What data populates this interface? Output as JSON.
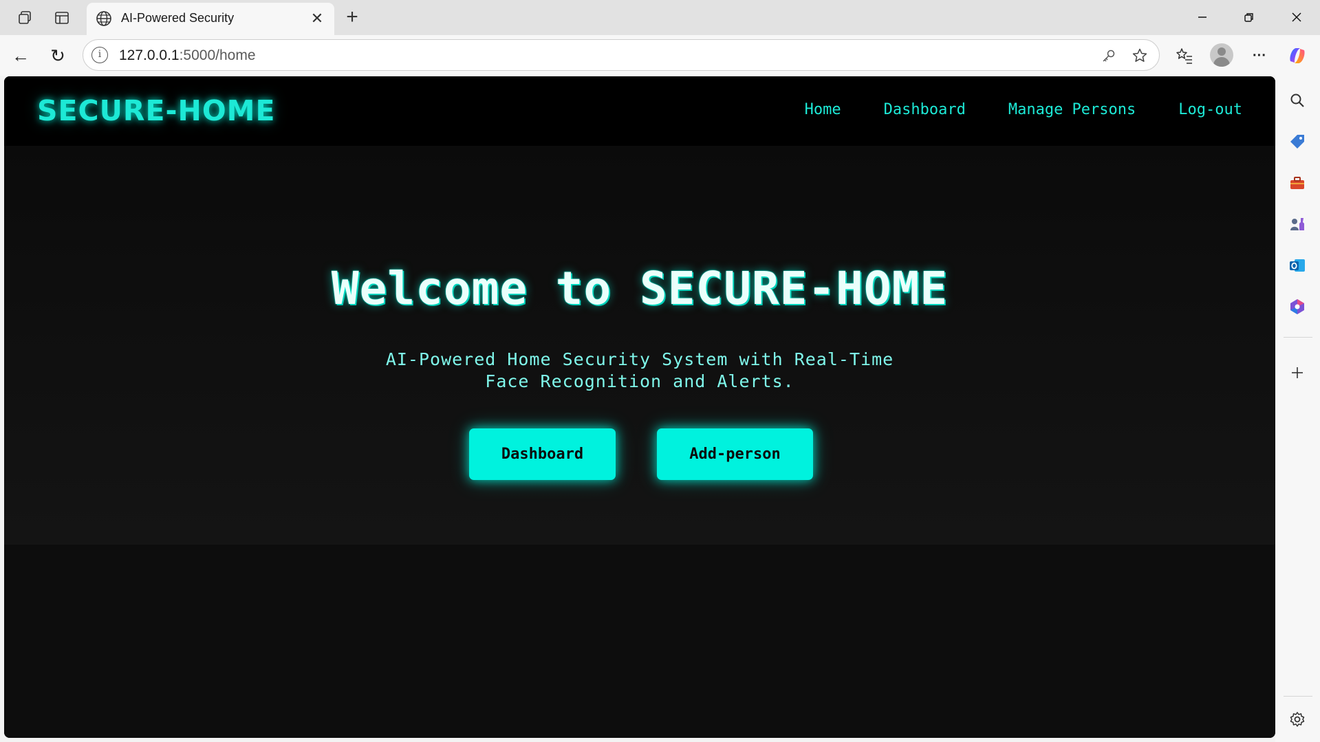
{
  "browser": {
    "tab_title": "AI-Powered Security",
    "url_host": "127.0.0.1",
    "url_path": ":5000/home",
    "close_glyph": "✕",
    "new_tab_glyph": "+",
    "minimize_glyph": "—",
    "restore_glyph": "❐",
    "window_close_glyph": "✕",
    "back_glyph": "←",
    "reload_glyph": "↻",
    "more_glyph": "···",
    "info_glyph": "i"
  },
  "site": {
    "brand": "SECURE-HOME",
    "nav": [
      {
        "label": "Home"
      },
      {
        "label": "Dashboard"
      },
      {
        "label": "Manage Persons"
      },
      {
        "label": "Log-out"
      }
    ],
    "hero_title": "Welcome to SECURE-HOME",
    "hero_subtitle": "AI-Powered Home Security System with Real-Time Face Recognition and Alerts.",
    "buttons": {
      "dashboard": "Dashboard",
      "add_person": "Add-person"
    }
  },
  "colors": {
    "accent": "#1de9d6",
    "button_bg": "#00f2de",
    "page_bg": "#0c0c0c",
    "nav_bg": "#000000"
  },
  "icons": {
    "sidebar": [
      "search-icon",
      "shopping-tag-icon",
      "toolbox-icon",
      "games-icon",
      "outlook-icon",
      "m365-icon",
      "add-icon",
      "settings-icon"
    ]
  }
}
